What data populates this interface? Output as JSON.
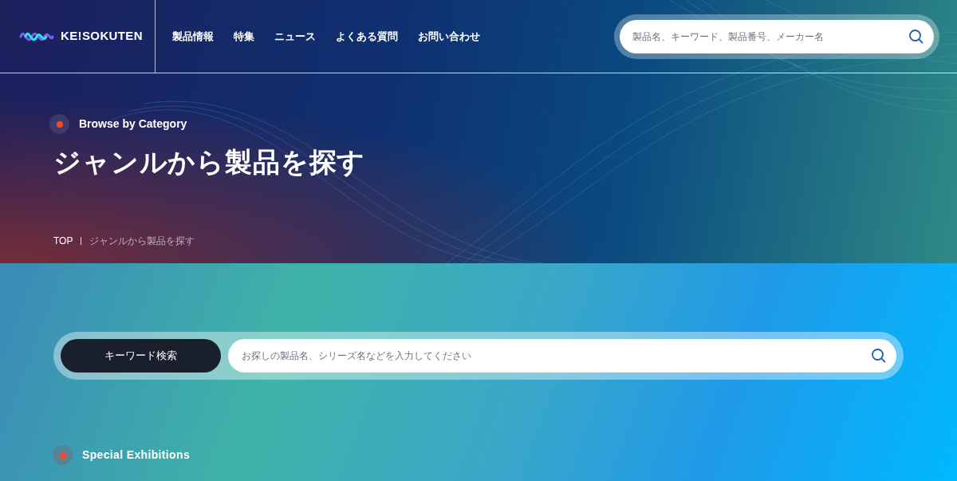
{
  "header": {
    "logo": "KE!SOKUTEN",
    "nav": [
      "製品情報",
      "特集",
      "ニュース",
      "よくある質問",
      "お問い合わせ"
    ],
    "search": {
      "placeholder": "製品名、キーワード、製品番号、メーカー名"
    }
  },
  "hero": {
    "eyebrow": "Browse by Category",
    "title": "ジャンルから製品を探す",
    "breadcrumb": [
      "TOP",
      "ジャンルから製品を探す"
    ]
  },
  "keyword_search": {
    "button": "キーワード検索",
    "placeholder": "お探しの製品名、シリーズ名などを入力してください"
  },
  "section": {
    "eyebrow": "Special Exhibitions"
  }
}
